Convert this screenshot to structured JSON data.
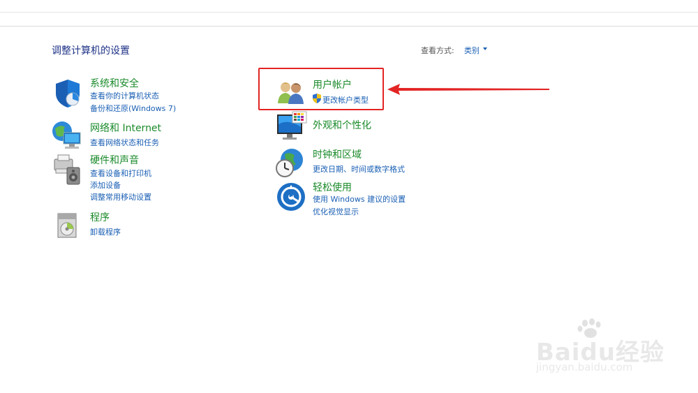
{
  "header": {
    "title": "调整计算机的设置"
  },
  "view_by": {
    "label": "查看方式:",
    "value": "类别"
  },
  "categories": {
    "system_security": {
      "title": "系统和安全",
      "links": [
        "查看你的计算机状态",
        "备份和还原(Windows 7)"
      ],
      "icon": "shield-icon"
    },
    "network": {
      "title": "网络和 Internet",
      "links": [
        "查看网络状态和任务"
      ],
      "icon": "network-globe-icon"
    },
    "hardware": {
      "title": "硬件和声音",
      "links": [
        "查看设备和打印机",
        "添加设备",
        "调整常用移动设置"
      ],
      "icon": "printer-speaker-icon"
    },
    "programs": {
      "title": "程序",
      "links": [
        "卸载程序"
      ],
      "icon": "programs-disc-icon"
    },
    "user_accounts": {
      "title": "用户帐户",
      "links": [
        "更改帐户类型"
      ],
      "icon": "users-icon"
    },
    "appearance": {
      "title": "外观和个性化",
      "links": [],
      "icon": "monitor-palette-icon"
    },
    "clock_region": {
      "title": "时钟和区域",
      "links": [
        "更改日期、时间或数字格式"
      ],
      "icon": "clock-globe-icon"
    },
    "ease_access": {
      "title": "轻松使用",
      "links": [
        "使用 Windows 建议的设置",
        "优化视觉显示"
      ],
      "icon": "ease-of-access-icon"
    }
  },
  "watermark": {
    "brand": "Baidu经验",
    "url": "jingyan.baidu.com"
  },
  "colors": {
    "category_title": "#1a8a2a",
    "link": "#1a5fb4",
    "highlight": "#e32424"
  }
}
